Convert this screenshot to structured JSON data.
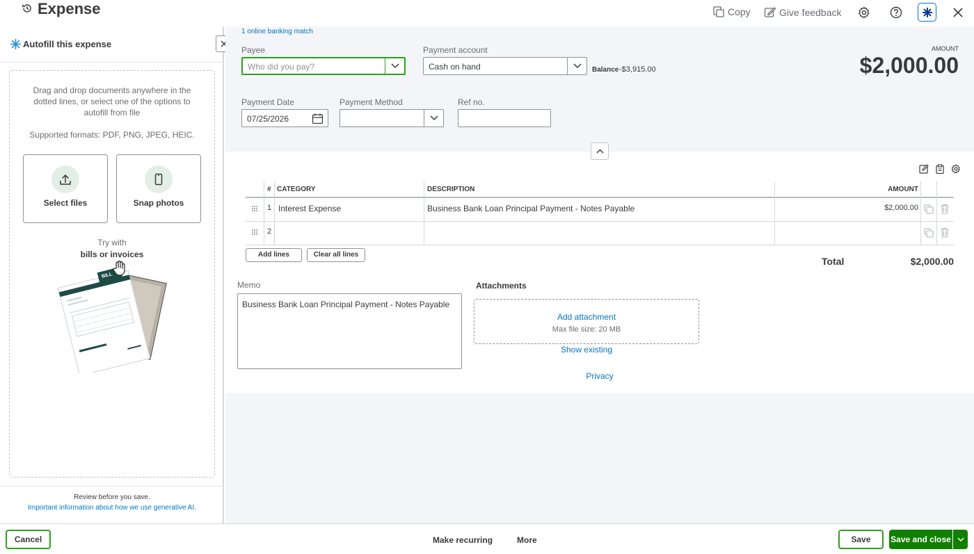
{
  "header": {
    "title": "Expense",
    "copy_label": "Copy",
    "feedback_label": "Give feedback"
  },
  "left_panel": {
    "title": "Autofill this expense",
    "instructions": "Drag and drop documents anywhere in the dotted lines, or select one of the options to autofill from file",
    "formats": "Supported formats: PDF, PNG, JPEG, HEIC.",
    "select_files_label": "Select files",
    "snap_photos_label": "Snap photos",
    "try_with": "Try with",
    "try_with_bold": "bills or invoices",
    "sample_doc_badge": "BILL",
    "review_text": "Review before you save.",
    "ai_info_link": "Important information about how we use generative AI."
  },
  "form": {
    "banking_match": "1 online banking match",
    "payee": {
      "label": "Payee",
      "placeholder": "Who did you pay?",
      "value": ""
    },
    "payment_account": {
      "label": "Payment account",
      "value": "Cash on hand"
    },
    "balance": {
      "label": "Balance",
      "value": "-$3,915.00"
    },
    "amount": {
      "label": "AMOUNT",
      "value": "$2,000.00"
    },
    "payment_date": {
      "label": "Payment Date",
      "value": "07/25/2026"
    },
    "payment_method": {
      "label": "Payment Method",
      "value": ""
    },
    "ref_no": {
      "label": "Ref no.",
      "value": ""
    }
  },
  "table": {
    "columns": {
      "num": "#",
      "category": "CATEGORY",
      "description": "DESCRIPTION",
      "amount": "AMOUNT"
    },
    "rows": [
      {
        "num": "1",
        "category": "Interest Expense",
        "description": "Business Bank Loan Principal Payment - Notes Payable",
        "amount": "$2,000.00"
      },
      {
        "num": "2",
        "category": "",
        "description": "",
        "amount": ""
      }
    ],
    "add_lines": "Add lines",
    "clear_lines": "Clear all lines",
    "total_label": "Total",
    "total_value": "$2,000.00"
  },
  "memo": {
    "label": "Memo",
    "value": "Business Bank Loan Principal Payment - Notes Payable"
  },
  "attachments": {
    "label": "Attachments",
    "add_label": "Add attachment",
    "max_size": "Max file size: 20 MB",
    "show_existing": "Show existing",
    "privacy": "Privacy"
  },
  "footer": {
    "cancel": "Cancel",
    "make_recurring": "Make recurring",
    "more": "More",
    "save": "Save",
    "save_close": "Save and close"
  },
  "colors": {
    "brand_green": "#2ca01c",
    "link_blue": "#0077c5",
    "save_green": "#108000"
  }
}
